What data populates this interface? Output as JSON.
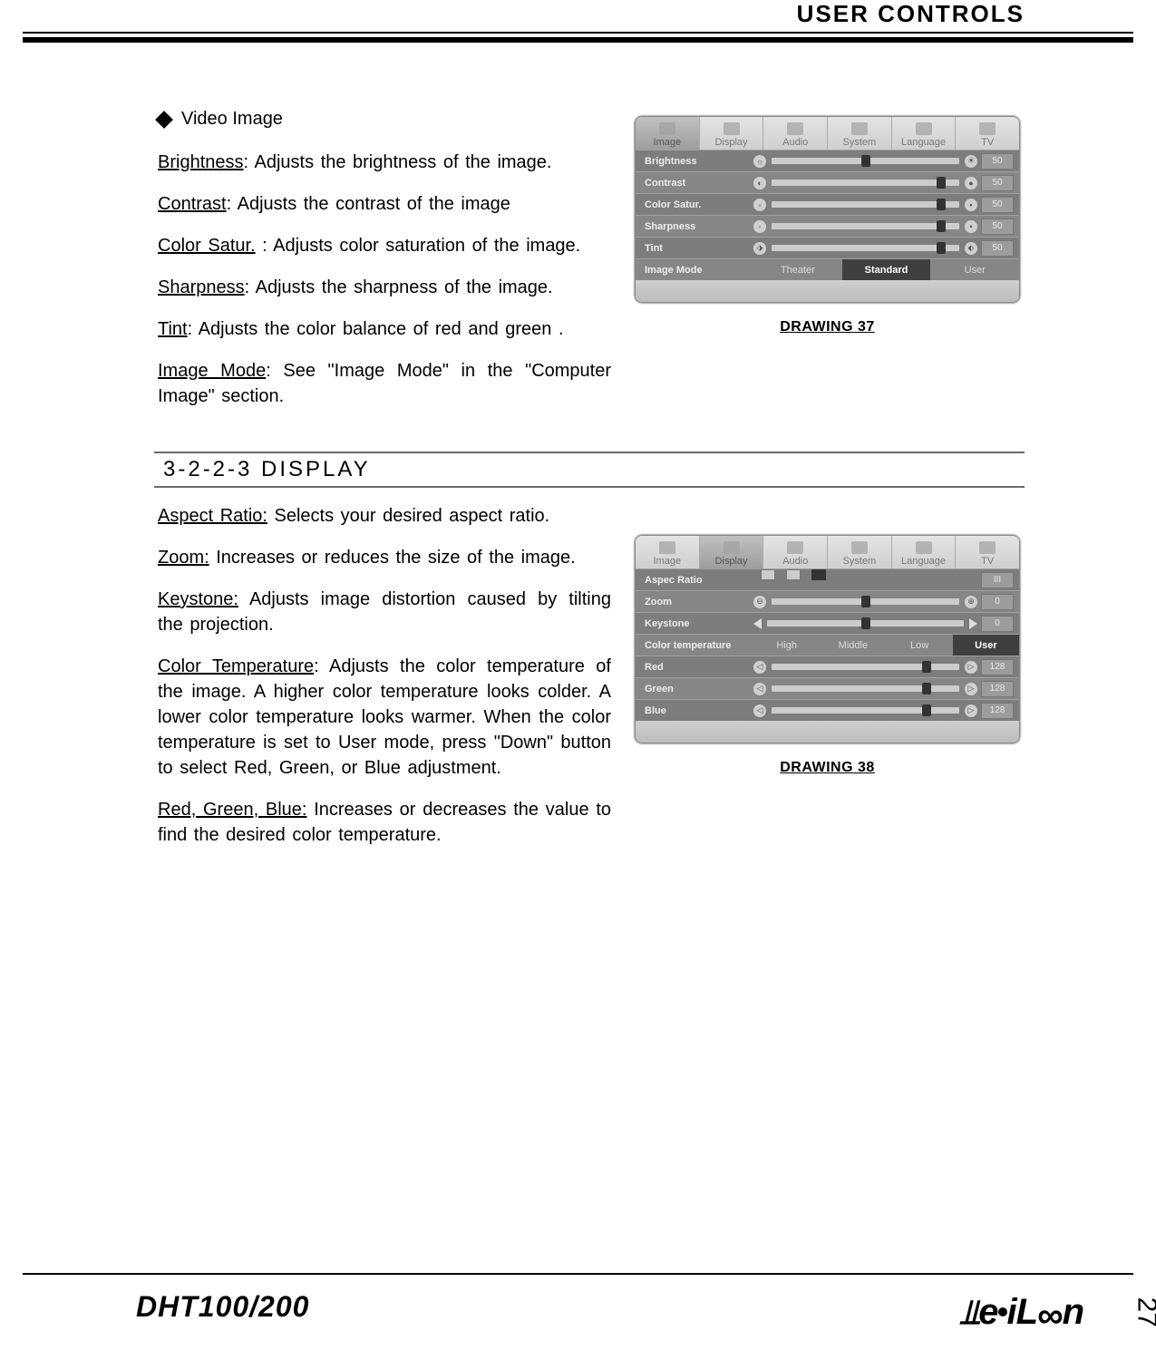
{
  "header": {
    "title": "USER CONTROLS"
  },
  "video_image": {
    "bullet": "Video Image",
    "items": [
      {
        "term": "Brightness",
        "desc": ": Adjusts the brightness of the image."
      },
      {
        "term": "Contrast",
        "desc": ": Adjusts the contrast of the image"
      },
      {
        "term": "Color Satur.",
        "desc": " : Adjusts color saturation of the image."
      },
      {
        "term": "Sharpness",
        "desc": ": Adjusts the sharpness of the image."
      },
      {
        "term": "Tint",
        "desc": ": Adjusts the color balance of red and green ."
      },
      {
        "term": "Image Mode",
        "desc": ": See \"Image Mode\" in the \"Computer Image\" section."
      }
    ]
  },
  "section_heading": "3-2-2-3    DISPLAY",
  "display": {
    "items": [
      {
        "term": "Aspect Ratio:",
        "desc": " Selects your desired aspect ratio."
      },
      {
        "term": "Zoom:",
        "desc": " Increases or reduces the size of the image."
      },
      {
        "term": "Keystone:",
        "desc": " Adjusts image distortion caused by tilting the projection."
      },
      {
        "term": "Color Temperature",
        "desc": ": Adjusts the color temperature of the image. A higher color temperature looks colder. A lower color temperature looks warmer. When the color temperature is set to User mode, press \"Down\" button to select Red, Green, or Blue adjustment."
      },
      {
        "term": "Red, Green, Blue:",
        "desc": " Increases or decreases the value to find the desired color temperature."
      }
    ]
  },
  "drawing37": {
    "caption": "DRAWING 37",
    "tabs": [
      "Image",
      "Display",
      "Audio",
      "System",
      "Language",
      "TV"
    ],
    "active_tab": 0,
    "rows": {
      "brightness": {
        "label": "Brightness",
        "value": "50"
      },
      "contrast": {
        "label": "Contrast",
        "value": "50"
      },
      "colorsatur": {
        "label": "Color Satur.",
        "value": "50"
      },
      "sharpness": {
        "label": "Sharpness",
        "value": "50"
      },
      "tint": {
        "label": "Tint",
        "value": "50"
      },
      "imagemode": {
        "label": "Image Mode",
        "options": [
          "Theater",
          "Standard",
          "User"
        ],
        "selected": "Standard"
      }
    }
  },
  "drawing38": {
    "caption": "DRAWING 38",
    "tabs": [
      "Image",
      "Display",
      "Audio",
      "System",
      "Language",
      "TV"
    ],
    "active_tab": 1,
    "rows": {
      "aspect": {
        "label": "Aspec Ratio",
        "value": "III"
      },
      "zoom": {
        "label": "Zoom",
        "value": "0"
      },
      "keystone": {
        "label": "Keystone",
        "value": "0"
      },
      "colortemp": {
        "label": "Color temperature",
        "options": [
          "High",
          "Middle",
          "Low",
          "User"
        ],
        "selected": "User"
      },
      "red": {
        "label": "Red",
        "value": "128"
      },
      "green": {
        "label": "Green",
        "value": "128"
      },
      "blue": {
        "label": "Blue",
        "value": "128"
      }
    }
  },
  "footer": {
    "model": "DHT100/200",
    "brand": "MeiLoon",
    "page": "27"
  }
}
